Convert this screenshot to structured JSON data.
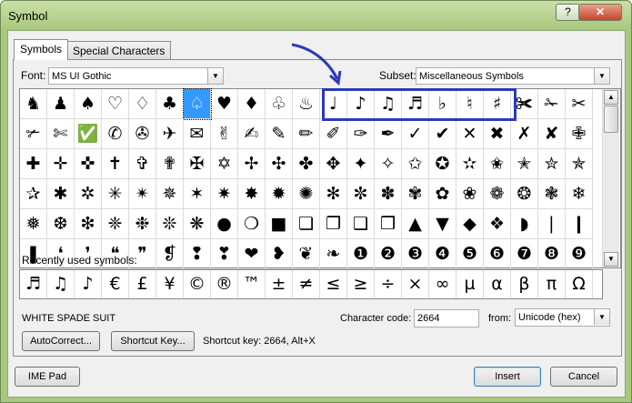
{
  "window": {
    "title": "Symbol",
    "help_label": "?",
    "close_label": "✕"
  },
  "tabs": [
    {
      "label": "Symbols",
      "active": true
    },
    {
      "label": "Special Characters",
      "active": false
    }
  ],
  "font": {
    "label": "Font:",
    "value": "MS UI Gothic"
  },
  "subset": {
    "label": "Subset:",
    "value": "Miscellaneous Symbols"
  },
  "grid": {
    "rows": [
      [
        "♞",
        "♟",
        "♠",
        "♡",
        "♢",
        "♣",
        "♤",
        "♥",
        "♦",
        "♧",
        "♨",
        "♩",
        "♪",
        "♫",
        "♬",
        "♭",
        "♮",
        "♯",
        "✀",
        "✁",
        "✂"
      ],
      [
        "✃",
        "✄",
        "✅",
        "✆",
        "✇",
        "✈",
        "✉",
        "✌",
        "✍",
        "✎",
        "✏",
        "✐",
        "✑",
        "✒",
        "✓",
        "✔",
        "✕",
        "✖",
        "✗",
        "✘",
        "✙"
      ],
      [
        "✚",
        "✛",
        "✜",
        "✝",
        "✞",
        "✟",
        "✠",
        "✡",
        "✢",
        "✣",
        "✤",
        "✥",
        "✦",
        "✧",
        "✩",
        "✪",
        "✫",
        "✬",
        "✭",
        "✮",
        "✯"
      ],
      [
        "✰",
        "✱",
        "✲",
        "✳",
        "✴",
        "✵",
        "✶",
        "✷",
        "✸",
        "✹",
        "✺",
        "✻",
        "✼",
        "✽",
        "✾",
        "✿",
        "❀",
        "❁",
        "❂",
        "❃",
        "❄"
      ],
      [
        "❅",
        "❆",
        "❇",
        "❈",
        "❉",
        "❊",
        "❋",
        "●",
        "❍",
        "■",
        "❏",
        "❐",
        "❑",
        "❒",
        "▲",
        "▼",
        "◆",
        "❖",
        "◗",
        "❘",
        "❙"
      ],
      [
        "❚",
        "❛",
        "❜",
        "❝",
        "❞",
        "❡",
        "❢",
        "❣",
        "❤",
        "❥",
        "❦",
        "❧",
        "❶",
        "❷",
        "❸",
        "❹",
        "❺",
        "❻",
        "❼",
        "❽",
        "❾"
      ]
    ],
    "selected_index": 6
  },
  "recent": {
    "label": "Recently used symbols:",
    "symbols": [
      "♬",
      "♫",
      "♪",
      "€",
      "£",
      "¥",
      "©",
      "®",
      "™",
      "±",
      "≠",
      "≤",
      "≥",
      "÷",
      "×",
      "∞",
      "µ",
      "α",
      "β",
      "π",
      "Ω"
    ]
  },
  "char_name": "WHITE SPADE SUIT",
  "char_code": {
    "label": "Character code:",
    "value": "2664"
  },
  "from": {
    "label": "from:",
    "value": "Unicode (hex)"
  },
  "buttons": {
    "autocorrect": "AutoCorrect...",
    "shortcut_key": "Shortcut Key...",
    "ime_pad": "IME Pad",
    "insert": "Insert",
    "cancel": "Cancel"
  },
  "shortcut_text": "Shortcut key: 2664, Alt+X"
}
